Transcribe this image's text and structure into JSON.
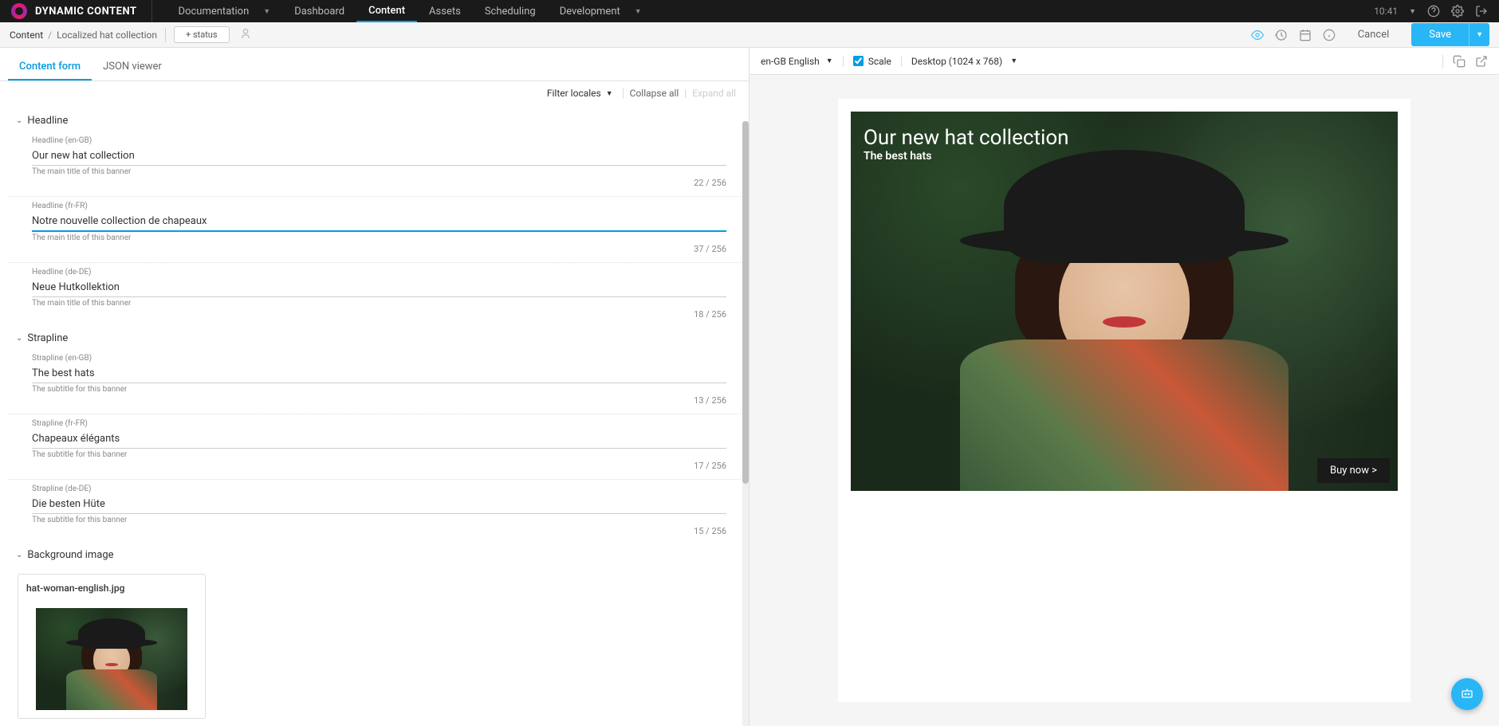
{
  "brand": "DYNAMIC CONTENT",
  "topnav": {
    "documentation": "Documentation",
    "dashboard": "Dashboard",
    "content": "Content",
    "assets": "Assets",
    "scheduling": "Scheduling",
    "development": "Development"
  },
  "time": "10:41",
  "breadcrumb": {
    "root": "Content",
    "current": "Localized hat collection"
  },
  "status_btn": "+ status",
  "cancel": "Cancel",
  "save": "Save",
  "tabs": {
    "form": "Content form",
    "json": "JSON viewer"
  },
  "form_toolbar": {
    "filter": "Filter locales",
    "collapse": "Collapse all",
    "expand": "Expand all"
  },
  "sections": {
    "headline": {
      "title": "Headline",
      "en": {
        "label": "Headline (en-GB)",
        "value": "Our new hat collection",
        "help": "The main title of this banner",
        "count": "22 / 256"
      },
      "fr": {
        "label": "Headline (fr-FR)",
        "value": "Notre nouvelle collection de chapeaux",
        "help": "The main title of this banner",
        "count": "37 / 256"
      },
      "de": {
        "label": "Headline (de-DE)",
        "value": "Neue Hutkollektion",
        "help": "The main title of this banner",
        "count": "18 / 256"
      }
    },
    "strapline": {
      "title": "Strapline",
      "en": {
        "label": "Strapline (en-GB)",
        "value": "The best hats",
        "help": "The subtitle for this banner",
        "count": "13 / 256"
      },
      "fr": {
        "label": "Strapline (fr-FR)",
        "value": "Chapeaux élégants",
        "help": "The subtitle for this banner",
        "count": "17 / 256"
      },
      "de": {
        "label": "Strapline (de-DE)",
        "value": "Die besten Hüte",
        "help": "The subtitle for this banner",
        "count": "15 / 256"
      }
    },
    "bgimage": {
      "title": "Background image",
      "filename": "hat-woman-english.jpg"
    }
  },
  "preview_toolbar": {
    "lang": "en-GB English",
    "scale": "Scale",
    "device": "Desktop (1024 x 768)"
  },
  "preview": {
    "headline": "Our new hat collection",
    "strapline": "The best hats",
    "cta": "Buy now >"
  }
}
